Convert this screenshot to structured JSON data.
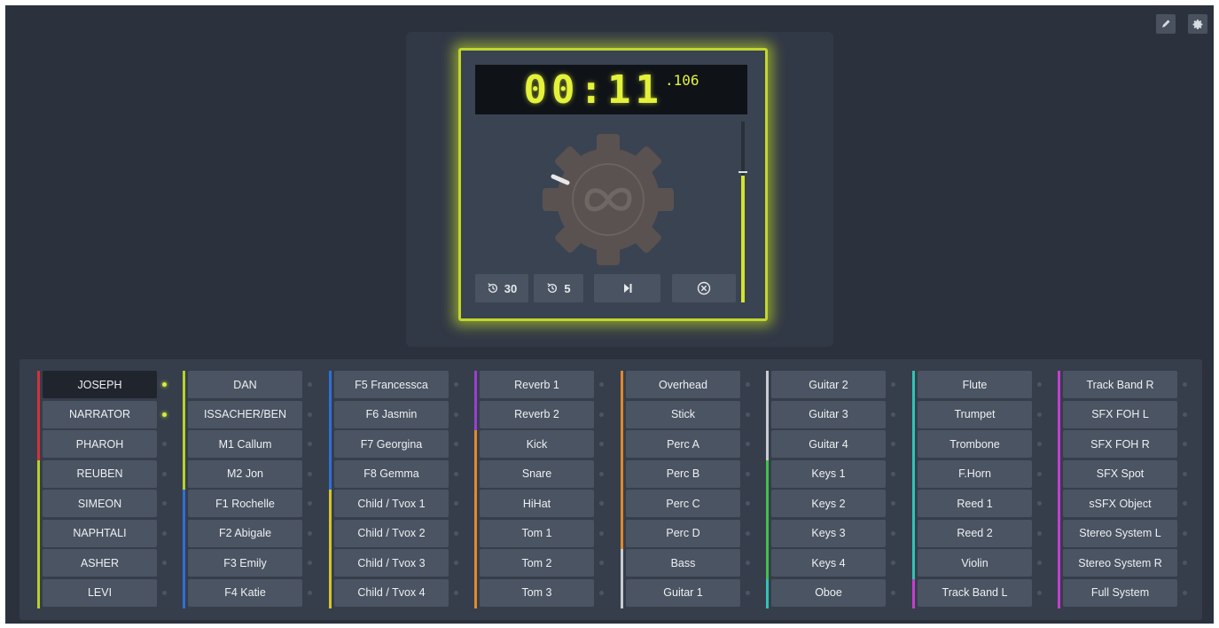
{
  "window": {
    "title": ""
  },
  "toolbar": {
    "edit_icon": "pencil-icon",
    "settings_icon": "gear-icon"
  },
  "player": {
    "time_main": "00:11",
    "time_ms": ".106",
    "knob_icon": "play-knob-icon",
    "meter_level": 0.7,
    "controls": {
      "rewind30_label": "30",
      "rewind5_label": "5",
      "skip_icon": "skip-next-icon",
      "stop_icon": "circle-x-icon"
    },
    "accent_color": "#c8e02a"
  },
  "columns": [
    {
      "channels": [
        {
          "label": "JOSEPH",
          "color": "#d0323c",
          "active": true,
          "on": true
        },
        {
          "label": "NARRATOR",
          "color": "#d0323c",
          "active": false,
          "on": true
        },
        {
          "label": "PHAROH",
          "color": "#d0323c",
          "active": false,
          "on": false
        },
        {
          "label": "REUBEN",
          "color": "#b6d12a",
          "active": false,
          "on": false
        },
        {
          "label": "SIMEON",
          "color": "#b6d12a",
          "active": false,
          "on": false
        },
        {
          "label": "NAPHTALI",
          "color": "#b6d12a",
          "active": false,
          "on": false
        },
        {
          "label": "ASHER",
          "color": "#b6d12a",
          "active": false,
          "on": false
        },
        {
          "label": "LEVI",
          "color": "#b6d12a",
          "active": false,
          "on": false
        }
      ]
    },
    {
      "channels": [
        {
          "label": "DAN",
          "color": "#b6d12a",
          "active": false,
          "on": false
        },
        {
          "label": "ISSACHER/BEN",
          "color": "#b6d12a",
          "active": false,
          "on": false
        },
        {
          "label": "M1 Callum",
          "color": "#b6d12a",
          "active": false,
          "on": false
        },
        {
          "label": "M2 Jon",
          "color": "#b6d12a",
          "active": false,
          "on": false
        },
        {
          "label": "F1 Rochelle",
          "color": "#2f6ed6",
          "active": false,
          "on": false
        },
        {
          "label": "F2 Abigale",
          "color": "#2f6ed6",
          "active": false,
          "on": false
        },
        {
          "label": "F3 Emily",
          "color": "#2f6ed6",
          "active": false,
          "on": false
        },
        {
          "label": "F4 Katie",
          "color": "#2f6ed6",
          "active": false,
          "on": false
        }
      ]
    },
    {
      "channels": [
        {
          "label": "F5 Francessca",
          "color": "#2f6ed6",
          "active": false,
          "on": false
        },
        {
          "label": "F6 Jasmin",
          "color": "#2f6ed6",
          "active": false,
          "on": false
        },
        {
          "label": "F7 Georgina",
          "color": "#2f6ed6",
          "active": false,
          "on": false
        },
        {
          "label": "F8 Gemma",
          "color": "#2f6ed6",
          "active": false,
          "on": false
        },
        {
          "label": "Child / Tvox 1",
          "color": "#d6c52a",
          "active": false,
          "on": false
        },
        {
          "label": "Child / Tvox 2",
          "color": "#d6c52a",
          "active": false,
          "on": false
        },
        {
          "label": "Child / Tvox 3",
          "color": "#d6c52a",
          "active": false,
          "on": false
        },
        {
          "label": "Child / Tvox 4",
          "color": "#d6c52a",
          "active": false,
          "on": false
        }
      ]
    },
    {
      "channels": [
        {
          "label": "Reverb 1",
          "color": "#9a3fd0",
          "active": false,
          "on": false
        },
        {
          "label": "Reverb 2",
          "color": "#9a3fd0",
          "active": false,
          "on": false
        },
        {
          "label": "Kick",
          "color": "#e08a2c",
          "active": false,
          "on": false
        },
        {
          "label": "Snare",
          "color": "#e08a2c",
          "active": false,
          "on": false
        },
        {
          "label": "HiHat",
          "color": "#e08a2c",
          "active": false,
          "on": false
        },
        {
          "label": "Tom 1",
          "color": "#e08a2c",
          "active": false,
          "on": false
        },
        {
          "label": "Tom 2",
          "color": "#e08a2c",
          "active": false,
          "on": false
        },
        {
          "label": "Tom 3",
          "color": "#e08a2c",
          "active": false,
          "on": false
        }
      ]
    },
    {
      "channels": [
        {
          "label": "Overhead",
          "color": "#e08a2c",
          "active": false,
          "on": false
        },
        {
          "label": "Stick",
          "color": "#e08a2c",
          "active": false,
          "on": false
        },
        {
          "label": "Perc A",
          "color": "#e08a2c",
          "active": false,
          "on": false
        },
        {
          "label": "Perc B",
          "color": "#e08a2c",
          "active": false,
          "on": false
        },
        {
          "label": "Perc C",
          "color": "#e08a2c",
          "active": false,
          "on": false
        },
        {
          "label": "Perc D",
          "color": "#e08a2c",
          "active": false,
          "on": false
        },
        {
          "label": "Bass",
          "color": "#c8ccd2",
          "active": false,
          "on": false
        },
        {
          "label": "Guitar 1",
          "color": "#c8ccd2",
          "active": false,
          "on": false
        }
      ]
    },
    {
      "channels": [
        {
          "label": "Guitar 2",
          "color": "#c8ccd2",
          "active": false,
          "on": false
        },
        {
          "label": "Guitar 3",
          "color": "#c8ccd2",
          "active": false,
          "on": false
        },
        {
          "label": "Guitar 4",
          "color": "#c8ccd2",
          "active": false,
          "on": false
        },
        {
          "label": "Keys 1",
          "color": "#3fc24a",
          "active": false,
          "on": false
        },
        {
          "label": "Keys 2",
          "color": "#3fc24a",
          "active": false,
          "on": false
        },
        {
          "label": "Keys 3",
          "color": "#3fc24a",
          "active": false,
          "on": false
        },
        {
          "label": "Keys 4",
          "color": "#3fc24a",
          "active": false,
          "on": false
        },
        {
          "label": "Oboe",
          "color": "#2fc4b4",
          "active": false,
          "on": false
        }
      ]
    },
    {
      "channels": [
        {
          "label": "Flute",
          "color": "#2fc4b4",
          "active": false,
          "on": false
        },
        {
          "label": "Trumpet",
          "color": "#2fc4b4",
          "active": false,
          "on": false
        },
        {
          "label": "Trombone",
          "color": "#2fc4b4",
          "active": false,
          "on": false
        },
        {
          "label": "F.Horn",
          "color": "#2fc4b4",
          "active": false,
          "on": false
        },
        {
          "label": "Reed 1",
          "color": "#2fc4b4",
          "active": false,
          "on": false
        },
        {
          "label": "Reed 2",
          "color": "#2fc4b4",
          "active": false,
          "on": false
        },
        {
          "label": "Violin",
          "color": "#2fc4b4",
          "active": false,
          "on": false
        },
        {
          "label": "Track Band L",
          "color": "#c43fcf",
          "active": false,
          "on": false
        }
      ]
    },
    {
      "channels": [
        {
          "label": "Track Band R",
          "color": "#c43fcf",
          "active": false,
          "on": false
        },
        {
          "label": "SFX FOH L",
          "color": "#c43fcf",
          "active": false,
          "on": false
        },
        {
          "label": "SFX FOH R",
          "color": "#c43fcf",
          "active": false,
          "on": false
        },
        {
          "label": "SFX Spot",
          "color": "#c43fcf",
          "active": false,
          "on": false
        },
        {
          "label": "sSFX Object",
          "color": "#c43fcf",
          "active": false,
          "on": false
        },
        {
          "label": "Stereo System L",
          "color": "#c43fcf",
          "active": false,
          "on": false
        },
        {
          "label": "Stereo System R",
          "color": "#c43fcf",
          "active": false,
          "on": false
        },
        {
          "label": "Full System",
          "color": "#c43fcf",
          "active": false,
          "on": false
        }
      ]
    }
  ]
}
